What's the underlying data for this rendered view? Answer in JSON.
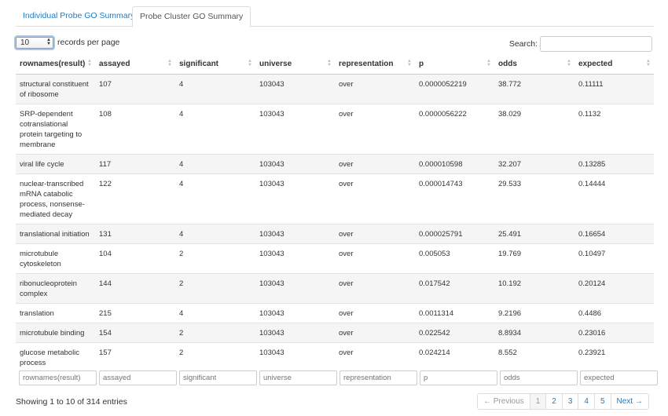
{
  "tabs": [
    {
      "label": "Individual Probe GO Summary",
      "active": false
    },
    {
      "label": "Probe Cluster GO Summary",
      "active": true
    }
  ],
  "length_control": {
    "value": "10",
    "label": "records per page"
  },
  "search": {
    "label": "Search:",
    "value": ""
  },
  "table": {
    "columns": [
      "rownames(result)",
      "assayed",
      "significant",
      "universe",
      "representation",
      "p",
      "odds",
      "expected"
    ],
    "rows": [
      [
        "structural constituent of ribosome",
        "107",
        "4",
        "103043",
        "over",
        "0.0000052219",
        "38.772",
        "0.11111"
      ],
      [
        "SRP-dependent cotranslational protein targeting to membrane",
        "108",
        "4",
        "103043",
        "over",
        "0.0000056222",
        "38.029",
        "0.1132"
      ],
      [
        "viral life cycle",
        "117",
        "4",
        "103043",
        "over",
        "0.000010598",
        "32.207",
        "0.13285"
      ],
      [
        "nuclear-transcribed mRNA catabolic process, nonsense-mediated decay",
        "122",
        "4",
        "103043",
        "over",
        "0.000014743",
        "29.533",
        "0.14444"
      ],
      [
        "translational initiation",
        "131",
        "4",
        "103043",
        "over",
        "0.000025791",
        "25.491",
        "0.16654"
      ],
      [
        "microtubule cytoskeleton",
        "104",
        "2",
        "103043",
        "over",
        "0.005053",
        "19.769",
        "0.10497"
      ],
      [
        "ribonucleoprotein complex",
        "144",
        "2",
        "103043",
        "over",
        "0.017542",
        "10.192",
        "0.20124"
      ],
      [
        "translation",
        "215",
        "4",
        "103043",
        "over",
        "0.0011314",
        "9.2196",
        "0.4486"
      ],
      [
        "microtubule binding",
        "154",
        "2",
        "103043",
        "over",
        "0.022542",
        "8.8934",
        "0.23016"
      ],
      [
        "glucose metabolic process",
        "157",
        "2",
        "103043",
        "over",
        "0.024214",
        "8.552",
        "0.23921"
      ]
    ]
  },
  "filters": [
    "rownames(result)",
    "assayed",
    "significant",
    "universe",
    "representation",
    "p",
    "odds",
    "expected"
  ],
  "info": "Showing 1 to 10 of 314 entries",
  "pagination": {
    "previous": "← Previous",
    "pages": [
      "1",
      "2",
      "3",
      "4",
      "5"
    ],
    "active_page": "1",
    "next": "Next →"
  },
  "colors": {
    "link": "#2a7ab8",
    "stripe": "#f5f5f5",
    "border": "#dddddd"
  },
  "icons": [
    "sort-icon",
    "spinner-arrows-icon"
  ]
}
